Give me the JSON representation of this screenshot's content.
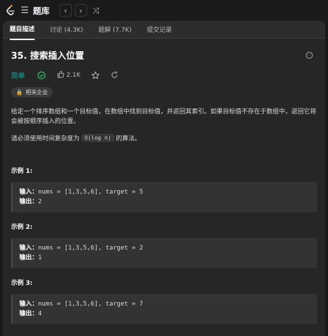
{
  "app": {
    "title": "题库",
    "menu_icon": "list-icon",
    "prev_label": "‹",
    "next_label": "›",
    "shuffle_icon": "shuffle-icon"
  },
  "tabs": [
    {
      "label": "题目描述",
      "active": true
    },
    {
      "label": "讨论 (4.3K)",
      "active": false
    },
    {
      "label": "题解 (7.7K)",
      "active": false
    },
    {
      "label": "提交记录",
      "active": false
    }
  ],
  "problem": {
    "title": "35. 搜索插入位置",
    "difficulty": "简单",
    "likes": "2.1K",
    "company_tag": "相关企业",
    "description": "给定一个排序数组和一个目标值，在数组中找到目标值，并返回其索引。如果目标值不存在于数组中，返回它将会被按顺序插入的位置。",
    "complexity_prefix": "请必须使用时间复杂度为",
    "complexity_code": "O(log n)",
    "complexity_suffix": "的算法。"
  },
  "examples": [
    {
      "title": "示例 1:",
      "input_label": "输入：",
      "input": "nums = [1,3,5,6], target = 5",
      "output_label": "输出：",
      "output": "2"
    },
    {
      "title": "示例 2:",
      "input_label": "输入：",
      "input": "nums = [1,3,5,6], target = 2",
      "output_label": "输出：",
      "output": "1"
    },
    {
      "title": "示例 3:",
      "input_label": "输入：",
      "input": "nums = [1,3,5,6], target = 7",
      "output_label": "输出：",
      "output": "4"
    }
  ],
  "colors": {
    "accent_easy": "#00b8a3",
    "accept_green": "#2cbb5d",
    "brand_orange": "#ffa116"
  }
}
